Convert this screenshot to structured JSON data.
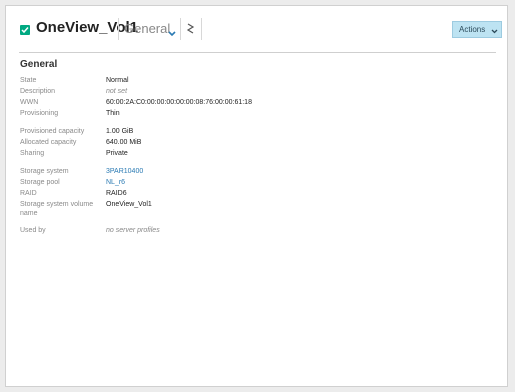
{
  "header": {
    "title": "OneView_Vol1",
    "view_label": "General",
    "actions_label": "Actions",
    "status_color": "#01a982",
    "accent_color": "#bde3f2"
  },
  "section": {
    "title": "General"
  },
  "groups": [
    {
      "rows": [
        {
          "label": "State",
          "value": "Normal"
        },
        {
          "label": "Description",
          "value": "not set",
          "style": "italic"
        },
        {
          "label": "WWN",
          "value": "60:00:2A:C0:00:00:00:00:00:08:76:00:00:61:18"
        },
        {
          "label": "Provisioning",
          "value": "Thin"
        }
      ]
    },
    {
      "rows": [
        {
          "label": "Provisioned capacity",
          "value": "1.00 GiB"
        },
        {
          "label": "Allocated capacity",
          "value": "640.00 MiB"
        },
        {
          "label": "Sharing",
          "value": "Private"
        }
      ]
    },
    {
      "rows": [
        {
          "label": "Storage system",
          "value": "3PAR10400",
          "style": "link"
        },
        {
          "label": "Storage pool",
          "value": "NL_r6",
          "style": "link"
        },
        {
          "label": "RAID",
          "value": "RAID6"
        },
        {
          "label": "Storage system volume name",
          "value": "OneView_Vol1"
        }
      ]
    },
    {
      "rows": [
        {
          "label": "Used by",
          "value": "no server profiles",
          "style": "italic"
        }
      ]
    }
  ]
}
